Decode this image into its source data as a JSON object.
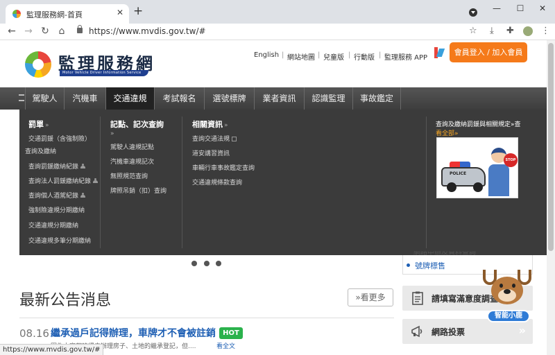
{
  "browser": {
    "tab_title": "監理服務網-首頁",
    "tab_close": "✕",
    "new_tab": "+",
    "url": "https://www.mvdis.gov.tw/#",
    "window": {
      "minimize": "—",
      "maximize": "☐",
      "close": "✕"
    },
    "nav": {
      "back": "←",
      "forward": "→",
      "reload": "↻",
      "home": "⌂"
    },
    "toolbar_icons": {
      "star": "☆",
      "download": "⤓",
      "extensions": "✚",
      "menu": "⋮"
    },
    "status_url": "https://www.mvdis.gov.tw/#"
  },
  "site": {
    "logo_text": "監理服務網",
    "logo_sub": "Motor Vehicle Driver Information Service",
    "top_links": [
      "English",
      "網站地圖",
      "兒童版",
      "行動版",
      "監理服務 APP"
    ],
    "top_sep": "|",
    "login_label": "會員登入 / 加入會員"
  },
  "nav": {
    "items": [
      "駕駛人",
      "汽機車",
      "交通違規",
      "考試報名",
      "選號標牌",
      "業者資訊",
      "認識監理",
      "事故鑑定"
    ],
    "active_index": 2
  },
  "dropdown": {
    "col1": {
      "heading": "罰單",
      "arrow": "»",
      "links": [
        "交通罰鍰（含強制險）",
        "查詢及繳納",
        "查詢罰鍰繳納紀錄",
        "查詢法人罰鍰繳納紀錄",
        "查詢個人酒駕紀錄",
        "強制險違規分期繳納",
        "交通違規分期繳納",
        "交通違規多筆分期繳納"
      ]
    },
    "col2": {
      "heading": "記點、記次查詢",
      "arrow": "»",
      "links": [
        "駕駛人違規記點",
        "汽機車違規記次",
        "無照規范查詢",
        "牌照吊銷（扣）查詢"
      ]
    },
    "col3": {
      "heading": "相關資訊",
      "arrow": "»",
      "links": [
        "查詢交通法規",
        "道安講習資訊",
        "車輛行車事故鑑定查詢",
        "交通違規條款查詢"
      ]
    },
    "promo": {
      "title": "查詢及繳納罰鍰與相關規定»查",
      "more": "看全部»",
      "car_label": "POLICE",
      "stop_label": "STOP"
    }
  },
  "carousel_dots": 3,
  "news": {
    "title": "最新公告消息",
    "more": "»看更多",
    "date": "08.16",
    "headline": "繼承過戶記得辦理，車牌才不會被註銷",
    "badge": "HOT",
    "snippet": "因為大家都曉得去辦理房子、土地的繼承登記，但....",
    "read_more": "看全文"
  },
  "sidebar": {
    "item_partial": "網路申辦及資料查詢",
    "item": "號牌標售",
    "cards": [
      "請填寫滿意度調查",
      "網路投票"
    ],
    "card_go": "»",
    "mascot_label": "智能小鹿"
  }
}
